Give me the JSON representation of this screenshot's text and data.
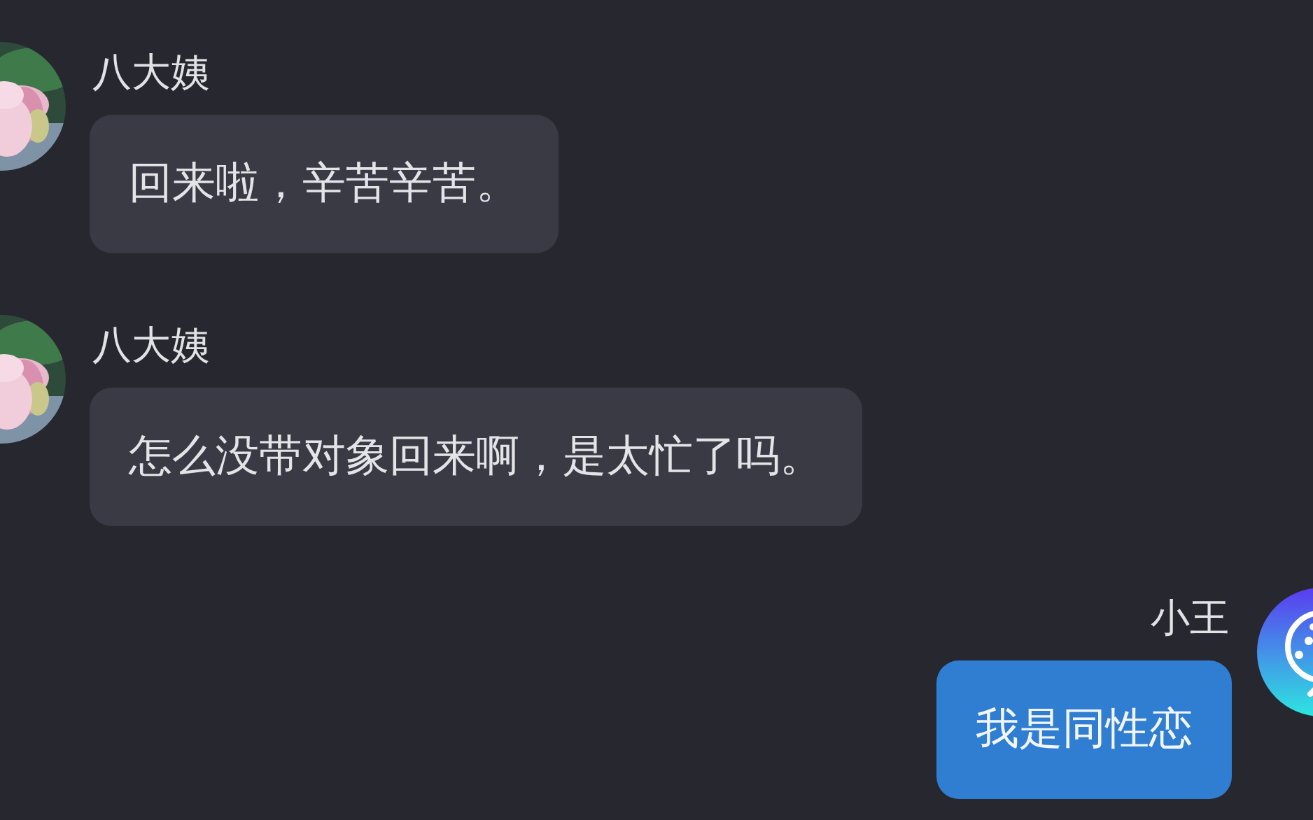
{
  "messages": [
    {
      "kind": "incoming",
      "sender": "八大姨",
      "text": "回来啦，辛苦辛苦。"
    },
    {
      "kind": "incoming",
      "sender": "八大姨",
      "text": "怎么没带对象回来啊，是太忙了吗。"
    },
    {
      "kind": "outgoing",
      "sender": "小王",
      "text": "我是同性恋"
    }
  ]
}
